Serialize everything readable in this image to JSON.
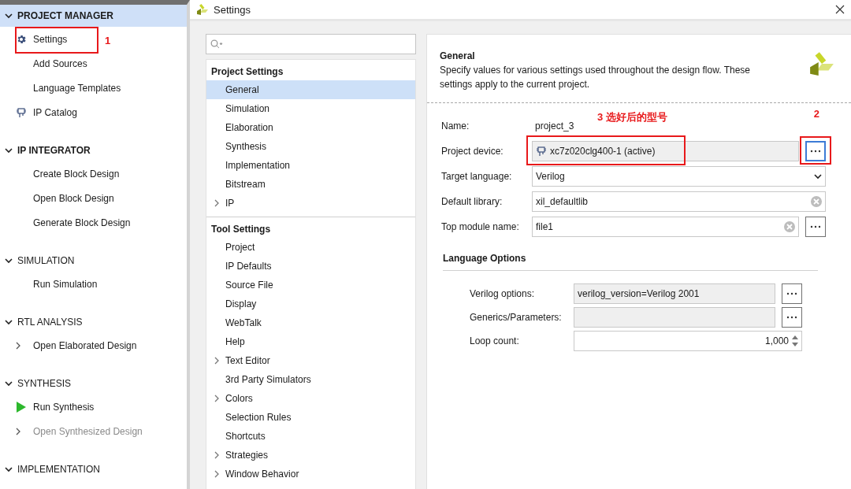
{
  "flow_navigator": {
    "sections": [
      {
        "title": "PROJECT MANAGER",
        "expanded": true,
        "selected": true,
        "emphasized": true,
        "items": [
          {
            "label": "Settings",
            "kind": "gear",
            "expandable": false,
            "disabled": false,
            "annotation": "1"
          },
          {
            "label": "Add Sources",
            "kind": "plain",
            "expandable": false,
            "disabled": false
          },
          {
            "label": "Language Templates",
            "kind": "plain",
            "expandable": false,
            "disabled": false
          },
          {
            "label": "IP Catalog",
            "kind": "chip",
            "expandable": false,
            "disabled": false
          }
        ]
      },
      {
        "title": "IP INTEGRATOR",
        "expanded": true,
        "selected": false,
        "emphasized": true,
        "items": [
          {
            "label": "Create Block Design",
            "kind": "plain",
            "expandable": false,
            "disabled": false
          },
          {
            "label": "Open Block Design",
            "kind": "plain",
            "expandable": false,
            "disabled": false
          },
          {
            "label": "Generate Block Design",
            "kind": "plain",
            "expandable": false,
            "disabled": false
          }
        ]
      },
      {
        "title": "SIMULATION",
        "expanded": true,
        "selected": false,
        "emphasized": false,
        "items": [
          {
            "label": "Run Simulation",
            "kind": "plain",
            "expandable": false,
            "disabled": false
          }
        ]
      },
      {
        "title": "RTL ANALYSIS",
        "expanded": true,
        "selected": false,
        "emphasized": false,
        "items": [
          {
            "label": "Open Elaborated Design",
            "kind": "plain",
            "expandable": true,
            "disabled": false
          }
        ]
      },
      {
        "title": "SYNTHESIS",
        "expanded": true,
        "selected": false,
        "emphasized": false,
        "items": [
          {
            "label": "Run Synthesis",
            "kind": "run",
            "expandable": false,
            "disabled": false
          },
          {
            "label": "Open Synthesized Design",
            "kind": "plain",
            "expandable": true,
            "disabled": true
          }
        ]
      },
      {
        "title": "IMPLEMENTATION",
        "expanded": true,
        "selected": false,
        "emphasized": false
      }
    ]
  },
  "dialog": {
    "title": "Settings",
    "tree": [
      {
        "title": "Project Settings",
        "items": [
          {
            "label": "General",
            "selected": true,
            "expandable": false
          },
          {
            "label": "Simulation",
            "selected": false,
            "expandable": false
          },
          {
            "label": "Elaboration",
            "selected": false,
            "expandable": false
          },
          {
            "label": "Synthesis",
            "selected": false,
            "expandable": false
          },
          {
            "label": "Implementation",
            "selected": false,
            "expandable": false
          },
          {
            "label": "Bitstream",
            "selected": false,
            "expandable": false
          },
          {
            "label": "IP",
            "selected": false,
            "expandable": true
          }
        ]
      },
      {
        "title": "Tool Settings",
        "items": [
          {
            "label": "Project",
            "selected": false,
            "expandable": false
          },
          {
            "label": "IP Defaults",
            "selected": false,
            "expandable": false
          },
          {
            "label": "Source File",
            "selected": false,
            "expandable": false
          },
          {
            "label": "Display",
            "selected": false,
            "expandable": false
          },
          {
            "label": "WebTalk",
            "selected": false,
            "expandable": false
          },
          {
            "label": "Help",
            "selected": false,
            "expandable": false
          },
          {
            "label": "Text Editor",
            "selected": false,
            "expandable": true
          },
          {
            "label": "3rd Party Simulators",
            "selected": false,
            "expandable": false
          },
          {
            "label": "Colors",
            "selected": false,
            "expandable": true
          },
          {
            "label": "Selection Rules",
            "selected": false,
            "expandable": false
          },
          {
            "label": "Shortcuts",
            "selected": false,
            "expandable": false
          },
          {
            "label": "Strategies",
            "selected": false,
            "expandable": true
          },
          {
            "label": "Window Behavior",
            "selected": false,
            "expandable": true
          }
        ]
      }
    ],
    "page": {
      "title": "General",
      "description": "Specify values for various settings used throughout the design flow. These settings apply to the current project.",
      "fields": [
        {
          "label": "Name:",
          "kind": "text",
          "value": "project_3"
        },
        {
          "label": "Project device:",
          "kind": "device",
          "value": "xc7z020clg400-1 (active)",
          "annotation": "3 选好后的型号",
          "button_annotation": "2"
        },
        {
          "label": "Target language:",
          "kind": "dropdown",
          "value": "Verilog"
        },
        {
          "label": "Default library:",
          "kind": "clearable",
          "value": "xil_defaultlib"
        },
        {
          "label": "Top module name:",
          "kind": "clearable_button",
          "value": "file1"
        }
      ],
      "language_options": {
        "title": "Language Options",
        "fields": [
          {
            "label": "Verilog options:",
            "kind": "readonly_button",
            "value": "verilog_version=Verilog 2001"
          },
          {
            "label": "Generics/Parameters:",
            "kind": "readonly_button"
          },
          {
            "label": "Loop count:",
            "kind": "spinner",
            "value": "1,000"
          }
        ]
      }
    }
  }
}
